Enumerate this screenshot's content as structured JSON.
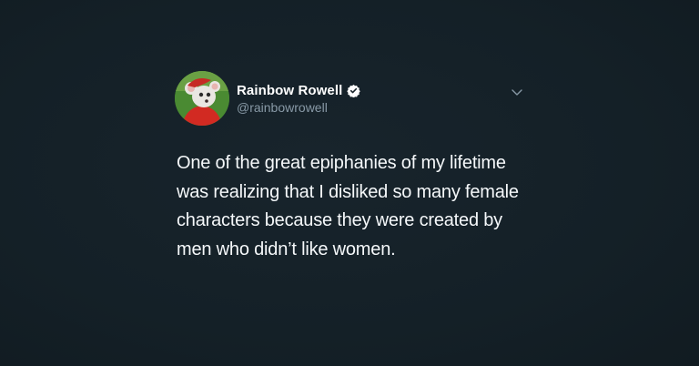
{
  "tweet": {
    "author": {
      "display_name": "Rainbow Rowell",
      "handle": "@rainbowrowell",
      "verified": true,
      "avatar_icon": "mouse-cartoon-avatar"
    },
    "text": "One of the great epiphanies of my lifetime was realizing that I disliked so many female characters because they were created by men who didn’t like women.",
    "menu_icon": "chevron-down-icon"
  },
  "colors": {
    "background": "#152027",
    "text": "#f5f8fa",
    "handle": "#8899a6",
    "verified_badge": "#ffffff"
  }
}
